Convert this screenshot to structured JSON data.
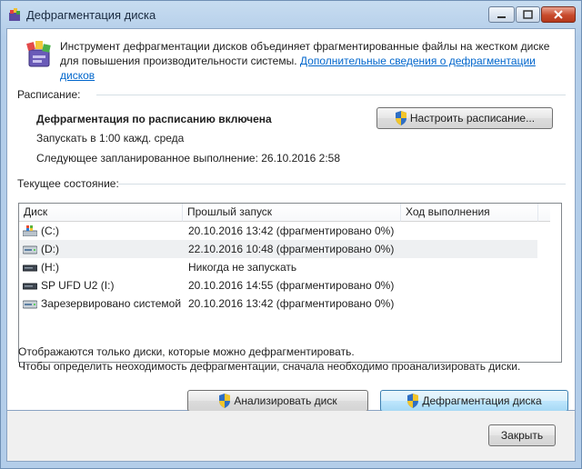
{
  "window": {
    "title": "Дефрагментация диска"
  },
  "intro": {
    "text": "Инструмент дефрагментации дисков объединяет фрагментированные файлы на жестком диске для повышения производительности системы.",
    "link": "Дополнительные сведения о дефрагментации дисков"
  },
  "schedule": {
    "label": "Расписание:",
    "status": "Дефрагментация по расписанию включена",
    "run": "Запускать в 1:00 кажд. среда",
    "next": "Следующее запланированное выполнение: 26.10.2016 2:58",
    "configure_button": "Настроить расписание..."
  },
  "current": {
    "label": "Текущее состояние:",
    "columns": [
      "Диск",
      "Прошлый запуск",
      "Ход выполнения"
    ],
    "rows": [
      {
        "disk": "(C:)",
        "last": "20.10.2016 13:42 (фрагментировано 0%)",
        "progress": "",
        "icon": "windows-drive-icon"
      },
      {
        "disk": "(D:)",
        "last": "22.10.2016 10:48 (фрагментировано 0%)",
        "progress": "",
        "icon": "hard-drive-icon"
      },
      {
        "disk": "(H:)",
        "last": "Никогда не запускать",
        "progress": "",
        "icon": "removable-drive-icon"
      },
      {
        "disk": "SP UFD U2 (I:)",
        "last": "20.10.2016 14:55 (фрагментировано 0%)",
        "progress": "",
        "icon": "removable-drive-icon"
      },
      {
        "disk": "Зарезервировано системой",
        "last": "20.10.2016 13:42 (фрагментировано 0%)",
        "progress": "",
        "icon": "hard-drive-icon"
      }
    ]
  },
  "notes": {
    "line1": "Отображаются только диски, которые можно дефрагментировать.",
    "line2": "Чтобы определить неоходимость  дефрагментации, сначала необходимо проанализировать диски."
  },
  "buttons": {
    "analyze": "Анализировать диск",
    "defrag": "Дефрагментация диска",
    "close": "Закрыть"
  },
  "colors": {
    "link": "#0066cc",
    "window_frame": "#b3cde9",
    "close_button": "#c84a2c"
  }
}
